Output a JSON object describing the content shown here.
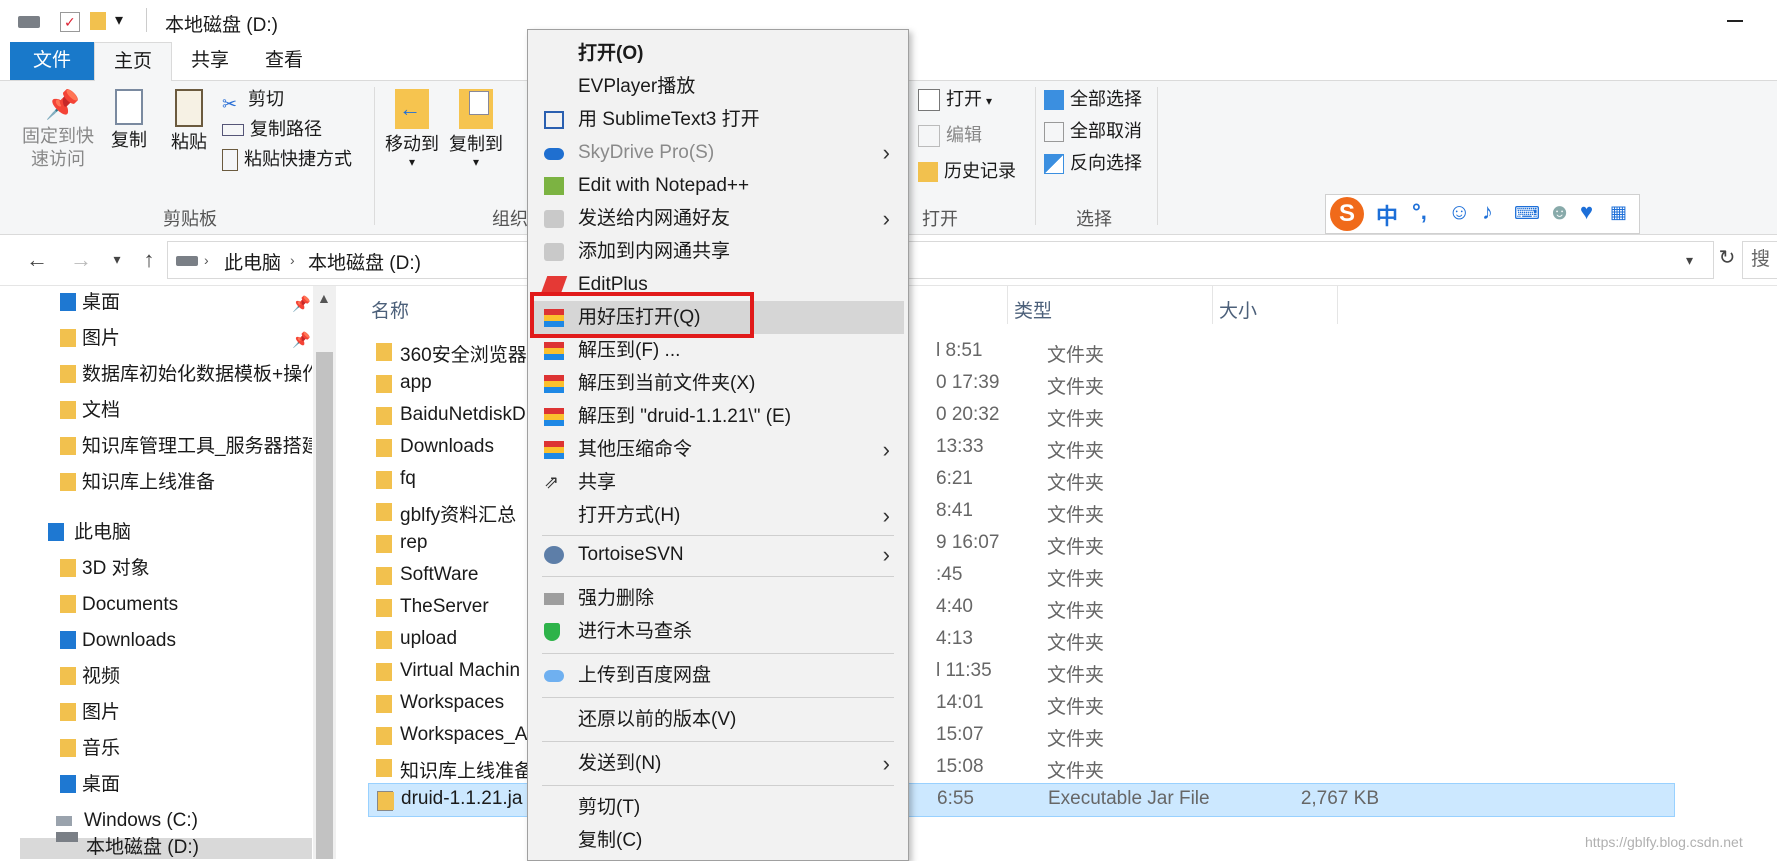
{
  "window": {
    "title": "本地磁盘 (D:)"
  },
  "ribbon_tabs": [
    "文件",
    "主页",
    "共享",
    "查看"
  ],
  "ribbon": {
    "clipboard": {
      "pin": "固定到快\n速访问",
      "pin_line1": "固定到快",
      "pin_line2": "速访问",
      "copy": "复制",
      "paste": "粘贴",
      "cut": "剪切",
      "copy_path": "复制路径",
      "paste_shortcut": "粘贴快捷方式",
      "group": "剪贴板"
    },
    "organize": {
      "move_to": "移动到",
      "copy_to": "复制到",
      "group": "组织"
    },
    "open": {
      "open": "打开",
      "edit": "编辑",
      "history": "历史记录",
      "group": "打开"
    },
    "select": {
      "select_all": "全部选择",
      "select_none": "全部取消",
      "invert": "反向选择",
      "group": "选择"
    }
  },
  "address": {
    "crumbs": [
      "此电脑",
      "本地磁盘 (D:)"
    ],
    "search_placeholder": "搜"
  },
  "navpane": {
    "quick": [
      {
        "label": "桌面",
        "icon": "desktop-folder-icon",
        "pinned": true
      },
      {
        "label": "图片",
        "icon": "pictures-folder-icon",
        "pinned": true
      },
      {
        "label": "数据库初始化数据模板+操作",
        "icon": "folder-icon",
        "pinned": false
      },
      {
        "label": "文档",
        "icon": "folder-icon",
        "pinned": false
      },
      {
        "label": "知识库管理工具_服务器搭建",
        "icon": "folder-icon",
        "pinned": false
      },
      {
        "label": "知识库上线准备",
        "icon": "folder-icon",
        "pinned": false
      }
    ],
    "this_pc": "此电脑",
    "pc_items": [
      {
        "label": "3D 对象",
        "icon": "3d-objects-icon"
      },
      {
        "label": "Documents",
        "icon": "documents-icon"
      },
      {
        "label": "Downloads",
        "icon": "downloads-icon"
      },
      {
        "label": "视频",
        "icon": "videos-icon"
      },
      {
        "label": "图片",
        "icon": "pictures-icon"
      },
      {
        "label": "音乐",
        "icon": "music-icon"
      },
      {
        "label": "桌面",
        "icon": "desktop-icon"
      },
      {
        "label": "Windows (C:)",
        "icon": "drive-icon"
      },
      {
        "label": "本地磁盘 (D:)",
        "icon": "drive-icon"
      }
    ]
  },
  "filelist": {
    "columns": {
      "name": "名称",
      "type": "类型",
      "size": "大小"
    },
    "rows": [
      {
        "name": "360安全浏览器",
        "date": "l 8:51",
        "type": "文件夹",
        "size": ""
      },
      {
        "name": "app",
        "date": "0 17:39",
        "type": "文件夹",
        "size": ""
      },
      {
        "name": "BaiduNetdiskD",
        "date": "0 20:32",
        "type": "文件夹",
        "size": ""
      },
      {
        "name": "Downloads",
        "date": "13:33",
        "type": "文件夹",
        "size": ""
      },
      {
        "name": "fq",
        "date": "6:21",
        "type": "文件夹",
        "size": ""
      },
      {
        "name": "gblfy资料汇总",
        "date": "8:41",
        "type": "文件夹",
        "size": ""
      },
      {
        "name": "rep",
        "date": "9 16:07",
        "type": "文件夹",
        "size": ""
      },
      {
        "name": "SoftWare",
        "date": ":45",
        "type": "文件夹",
        "size": ""
      },
      {
        "name": "TheServer",
        "date": "4:40",
        "type": "文件夹",
        "size": ""
      },
      {
        "name": "upload",
        "date": "4:13",
        "type": "文件夹",
        "size": ""
      },
      {
        "name": "Virtual Machin",
        "date": "l 11:35",
        "type": "文件夹",
        "size": ""
      },
      {
        "name": "Workspaces",
        "date": "14:01",
        "type": "文件夹",
        "size": ""
      },
      {
        "name": "Workspaces_A",
        "date": "15:07",
        "type": "文件夹",
        "size": ""
      },
      {
        "name": "知识库上线准备",
        "date": "15:08",
        "type": "文件夹",
        "size": ""
      },
      {
        "name": "druid-1.1.21.ja",
        "date": "6:55",
        "type": "Executable Jar File",
        "size": "2,767 KB"
      }
    ]
  },
  "context_menu": {
    "items": [
      {
        "label": "打开(O)",
        "bold": true
      },
      {
        "label": "EVPlayer播放"
      },
      {
        "label": "用 SublimeText3 打开",
        "icon": "sublime-icon"
      },
      {
        "label": "SkyDrive Pro(S)",
        "dim": true,
        "submenu": true,
        "icon": "cloud-icon"
      },
      {
        "label": "Edit with Notepad++",
        "icon": "notepad-icon"
      },
      {
        "label": "发送给内网通好友",
        "submenu": true,
        "icon": "share-app-icon"
      },
      {
        "label": "添加到内网通共享",
        "icon": "share-app-icon"
      },
      {
        "label": "EditPlus",
        "icon": "editplus-icon"
      },
      {
        "label": "用好压打开(Q)",
        "highlight": true,
        "icon": "haozip-icon"
      },
      {
        "label": "解压到(F) ...",
        "icon": "haozip-icon"
      },
      {
        "label": "解压到当前文件夹(X)",
        "icon": "haozip-icon"
      },
      {
        "label": "解压到 \"druid-1.1.21\\\" (E)",
        "icon": "haozip-icon"
      },
      {
        "label": "其他压缩命令",
        "submenu": true,
        "icon": "haozip-icon"
      },
      {
        "label": "共享",
        "icon": "share-icon"
      },
      {
        "label": "打开方式(H)",
        "submenu": true
      },
      {
        "label": "TortoiseSVN",
        "submenu": true,
        "icon": "tortoise-icon"
      },
      {
        "label": "强力删除",
        "icon": "shredder-icon"
      },
      {
        "label": "进行木马查杀",
        "icon": "shield-icon"
      },
      {
        "label": "上传到百度网盘",
        "icon": "baidu-cloud-icon"
      },
      {
        "label": "还原以前的版本(V)"
      },
      {
        "label": "发送到(N)",
        "submenu": true
      },
      {
        "label": "剪切(T)"
      },
      {
        "label": "复制(C)"
      }
    ]
  },
  "ime_toolbar": {
    "logo": "S",
    "mode": "中",
    "punct": "°,"
  },
  "watermark": "https://gblfy.blog.csdn.net",
  "colors": {
    "accent": "#1979ca",
    "selection": "#cce8ff",
    "highlight_box": "#e11a1a",
    "menu_bg": "#f2f2f2"
  }
}
